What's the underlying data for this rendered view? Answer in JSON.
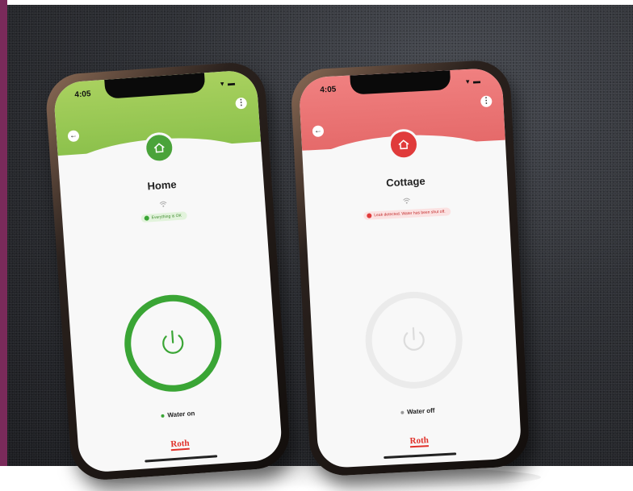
{
  "phones": [
    {
      "time": "4:05",
      "title": "Home",
      "status_text": "Everything is OK",
      "water_label": "Water on",
      "logo": "Roth",
      "theme": "green",
      "accent": "#3aa535",
      "water_state": "on"
    },
    {
      "time": "4:05",
      "title": "Cottage",
      "status_text": "Leak detected. Water has been shut off.",
      "water_label": "Water off",
      "logo": "Roth",
      "theme": "red",
      "accent": "#e03b3b",
      "water_state": "off"
    }
  ],
  "icons": {
    "back": "arrow-left-icon",
    "menu": "more-vertical-icon",
    "device": "house-icon",
    "connection": "wifi-icon",
    "power": "power-icon"
  }
}
